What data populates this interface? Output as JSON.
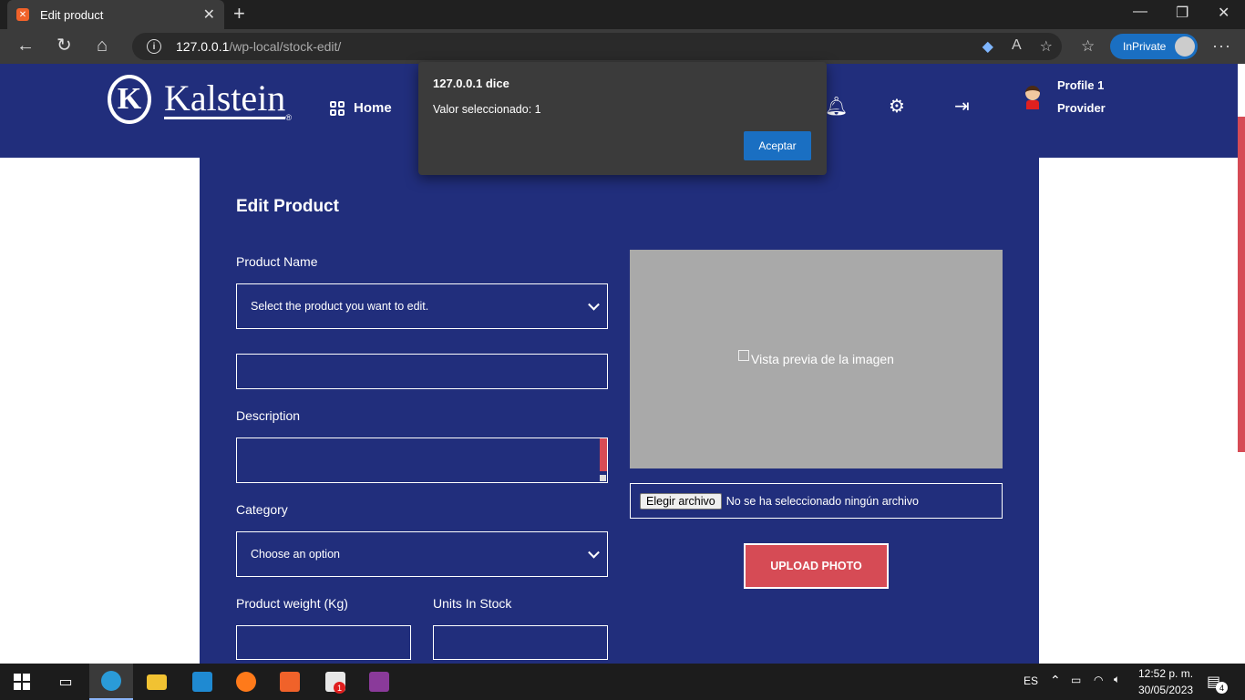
{
  "browser": {
    "tab_title": "Edit product",
    "url_host": "127.0.0.1",
    "url_path": "/wp-local/stock-edit/",
    "inprivate_label": "InPrivate"
  },
  "site": {
    "brand": "Kalstein",
    "brand_mark": "®",
    "nav_home": "Home",
    "profile_name": "Profile 1",
    "profile_role": "Provider"
  },
  "form": {
    "title": "Edit Product",
    "product_name_label": "Product Name",
    "product_select_value": "Select the product you want to edit.",
    "description_label": "Description",
    "category_label": "Category",
    "category_select_value": "Choose an option",
    "weight_label": "Product weight (Kg)",
    "units_label": "Units In Stock",
    "preview_alt": "Vista previa de la imagen",
    "file_button": "Elegir archivo",
    "file_status": "No se ha seleccionado ningún archivo",
    "upload_button": "UPLOAD PHOTO"
  },
  "dialog": {
    "title": "127.0.0.1 dice",
    "message": "Valor seleccionado: 1",
    "button": "Aceptar"
  },
  "taskbar": {
    "language": "ES",
    "time": "12:52 p. m.",
    "date": "30/05/2023",
    "notifications": "4",
    "app_badge": "1"
  },
  "colors": {
    "header_blue": "#212e7c",
    "accent_red": "#d64b55",
    "dialog_button": "#1a6fc2"
  }
}
